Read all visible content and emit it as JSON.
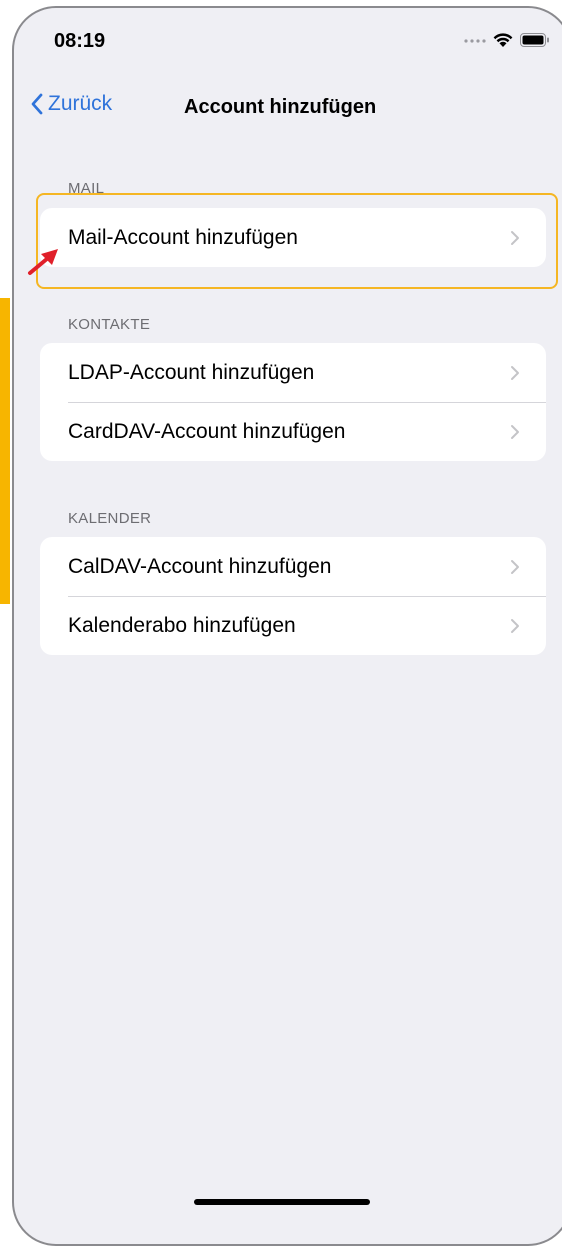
{
  "status_bar": {
    "time": "08:19",
    "icons": [
      "signal-dots-icon",
      "wifi-icon",
      "battery-icon"
    ]
  },
  "nav": {
    "back_label": "Zurück",
    "title": "Account hinzufügen"
  },
  "sections": [
    {
      "header": "MAIL",
      "items": [
        {
          "label": "Mail-Account hinzufügen"
        }
      ]
    },
    {
      "header": "KONTAKTE",
      "items": [
        {
          "label": "LDAP-Account hinzufügen"
        },
        {
          "label": "CardDAV-Account hinzufügen"
        }
      ]
    },
    {
      "header": "KALENDER",
      "items": [
        {
          "label": "CalDAV-Account hinzufügen"
        },
        {
          "label": "Kalenderabo hinzufügen"
        }
      ]
    }
  ],
  "colors": {
    "accent_blue": "#2f73da",
    "highlight_yellow": "#f5b623",
    "annotation_arrow": "#e0202a",
    "background": "#efeff4"
  }
}
